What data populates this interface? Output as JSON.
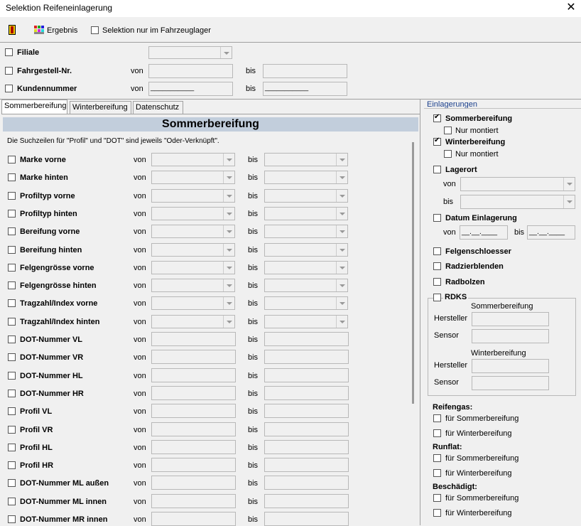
{
  "window": {
    "title": "Selektion Reifeneinlagerung"
  },
  "toolbar": {
    "exit_icon": "door-exit-icon",
    "result_icon": "colorful-grid-icon",
    "result_label": "Ergebnis",
    "stock_only_label": "Selektion nur im Fahrzeuglager"
  },
  "top_filters": {
    "branch_label": "Filiale",
    "chassis_label": "Fahrgestell-Nr.",
    "customer_label": "Kundennummer",
    "from_label": "von",
    "to_label": "bis",
    "customer_from_mask": "___________",
    "customer_to_mask": "___________"
  },
  "tabs": [
    "Sommerbereifung",
    "Winterbereifung",
    "Datenschutz"
  ],
  "main": {
    "banner": "Sommerbereifung",
    "hint": "Die Suchzeilen für \"Profil\" und \"DOT\" sind jeweils \"Oder-Verknüpft\".",
    "from_label": "von",
    "to_label": "bis",
    "rows": [
      {
        "label": "Marke vorne",
        "type": "combo"
      },
      {
        "label": "Marke hinten",
        "type": "combo"
      },
      {
        "label": "Profiltyp vorne",
        "type": "combo"
      },
      {
        "label": "Profiltyp hinten",
        "type": "combo"
      },
      {
        "label": "Bereifung vorne",
        "type": "combo"
      },
      {
        "label": "Bereifung hinten",
        "type": "combo"
      },
      {
        "label": "Felgengrösse vorne",
        "type": "combo"
      },
      {
        "label": "Felgengrösse hinten",
        "type": "combo"
      },
      {
        "label": "Tragzahl/Index vorne",
        "type": "combo"
      },
      {
        "label": "Tragzahl/Index hinten",
        "type": "combo"
      },
      {
        "label": "DOT-Nummer VL",
        "type": "text"
      },
      {
        "label": "DOT-Nummer VR",
        "type": "text"
      },
      {
        "label": "DOT-Nummer HL",
        "type": "text"
      },
      {
        "label": "DOT-Nummer HR",
        "type": "text"
      },
      {
        "label": "Profil VL",
        "type": "text"
      },
      {
        "label": "Profil VR",
        "type": "text"
      },
      {
        "label": "Profil HL",
        "type": "text"
      },
      {
        "label": "Profil HR",
        "type": "text"
      },
      {
        "label": "DOT-Nummer ML außen",
        "type": "text"
      },
      {
        "label": "DOT-Nummer ML innen",
        "type": "text"
      },
      {
        "label": "DOT-Nummer MR innen",
        "type": "text"
      }
    ]
  },
  "side": {
    "group_title": "Einlagerungen",
    "summer_label": "Sommerbereifung",
    "summer_checked": true,
    "winter_label": "Winterbereifung",
    "winter_checked": true,
    "mounted_label": "Nur montiert",
    "storage_label": "Lagerort",
    "from_label": "von",
    "to_label": "bis",
    "date_label": "Datum Einlagerung",
    "date_from_mask": "__.__.____",
    "date_to_mask": "__.__.____",
    "rim_locks_label": "Felgenschloesser",
    "hubcaps_label": "Radzierblenden",
    "wheel_bolts_label": "Radbolzen",
    "rdks_label": "RDKS",
    "rdks_summer": "Sommerbereifung",
    "rdks_winter": "Winterbereifung",
    "manufacturer_label": "Hersteller",
    "sensor_label": "Sensor",
    "tire_gas_label": "Reifengas:",
    "runflat_label": "Runflat:",
    "damaged_label": "Beschädigt:",
    "for_summer": "für Sommerbereifung",
    "for_winter": "für Winterbereifung"
  }
}
